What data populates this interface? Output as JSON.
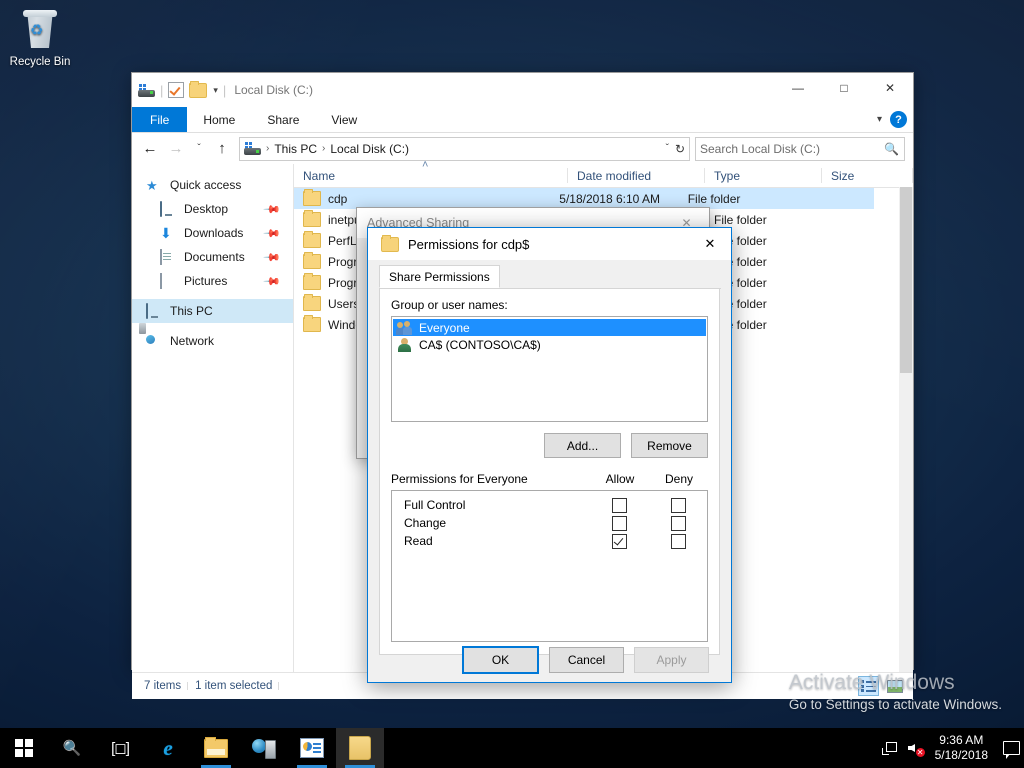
{
  "desktop": {
    "recycle_bin_label": "Recycle Bin",
    "recycle_bin_icon": "recycle-bin-icon",
    "watermark_line1": "Activate Windows",
    "watermark_line2": "Go to Settings to activate Windows."
  },
  "explorer": {
    "title": "Local Disk (C:)",
    "quick_access_icons": [
      "drive-icon",
      "properties-checkbox-icon",
      "new-folder-icon",
      "customize-caret-icon"
    ],
    "window_controls": {
      "minimize": "—",
      "maximize": "☐",
      "close": "✕"
    },
    "ribbon": {
      "tabs": [
        "File",
        "Home",
        "Share",
        "View"
      ],
      "collapse_caret": "ˇ",
      "help_label": "?"
    },
    "address": {
      "back": "←",
      "forward": "→",
      "recent_caret": "ˇ",
      "up": "↑",
      "drive_icon": "drive-icon",
      "crumbs": [
        "This PC",
        "Local Disk (C:)"
      ],
      "separator": "›",
      "dropdown_caret": "ˇ",
      "refresh": "↻"
    },
    "search": {
      "placeholder": "Search Local Disk (C:)",
      "icon": "search-icon"
    },
    "navigation": [
      {
        "label": "Quick access",
        "icon": "star-icon",
        "indent": false,
        "pinned": false,
        "selected": false
      },
      {
        "label": "Desktop",
        "icon": "desktop-icon",
        "indent": true,
        "pinned": true,
        "selected": false
      },
      {
        "label": "Downloads",
        "icon": "downloads-icon",
        "indent": true,
        "pinned": true,
        "selected": false
      },
      {
        "label": "Documents",
        "icon": "documents-icon",
        "indent": true,
        "pinned": true,
        "selected": false
      },
      {
        "label": "Pictures",
        "icon": "pictures-icon",
        "indent": true,
        "pinned": true,
        "selected": false
      },
      {
        "label": "This PC",
        "icon": "this-pc-icon",
        "indent": false,
        "pinned": false,
        "selected": true
      },
      {
        "label": "Network",
        "icon": "network-icon",
        "indent": false,
        "pinned": false,
        "selected": false
      }
    ],
    "columns": [
      "Name",
      "Date modified",
      "Type",
      "Size"
    ],
    "sort_indicator": "˄",
    "files": [
      {
        "name": "cdp",
        "date": "5/18/2018 6:10 AM",
        "type": "File folder",
        "size": "",
        "selected": true
      },
      {
        "name": "inetpub",
        "date": "",
        "type": "File folder",
        "size": "",
        "selected": false
      },
      {
        "name": "PerfLogs",
        "date": "",
        "type": "File folder",
        "size": "",
        "selected": false
      },
      {
        "name": "Program Files",
        "date": "",
        "type": "File folder",
        "size": "",
        "selected": false
      },
      {
        "name": "Program Files (x86)",
        "date": "",
        "type": "File folder",
        "size": "",
        "selected": false
      },
      {
        "name": "Users",
        "date": "",
        "type": "File folder",
        "size": "",
        "selected": false
      },
      {
        "name": "Windows",
        "date": "",
        "type": "File folder",
        "size": "",
        "selected": false
      }
    ],
    "status": {
      "item_count": "7 items",
      "selection": "1 item selected",
      "view_details_icon": "details-view-icon",
      "view_thumbnails_icon": "large-icons-view-icon"
    }
  },
  "advanced_sharing_dialog": {
    "title": "Advanced Sharing",
    "close": "✕"
  },
  "permissions_dialog": {
    "title": "Permissions for cdp$",
    "title_icon": "folder-icon",
    "close": "✕",
    "tab": "Share Permissions",
    "group_label": "Group or user names:",
    "users": [
      {
        "name": "Everyone",
        "icon": "group-icon",
        "selected": true
      },
      {
        "name": "CA$ (CONTOSO\\CA$)",
        "icon": "user-icon",
        "selected": false
      }
    ],
    "add_label": "Add...",
    "remove_label": "Remove",
    "permissions_for_label": "Permissions for Everyone",
    "allow_header": "Allow",
    "deny_header": "Deny",
    "permissions": [
      {
        "name": "Full Control",
        "allow": false,
        "deny": false
      },
      {
        "name": "Change",
        "allow": false,
        "deny": false
      },
      {
        "name": "Read",
        "allow": true,
        "deny": false
      }
    ],
    "ok_label": "OK",
    "cancel_label": "Cancel",
    "apply_label": "Apply",
    "apply_disabled": true
  },
  "taskbar": {
    "start_icon": "windows-start-icon",
    "search_icon": "search-icon",
    "task_view_icon": "task-view-icon",
    "apps": [
      {
        "name": "internet-explorer",
        "running": false,
        "active": false
      },
      {
        "name": "file-explorer",
        "running": true,
        "active": false
      },
      {
        "name": "server-manager",
        "running": false,
        "active": false
      },
      {
        "name": "management-console",
        "running": true,
        "active": false
      },
      {
        "name": "explorer-window",
        "running": true,
        "active": true
      }
    ],
    "tray": {
      "network_icon": "network-icon",
      "volume_icon": "volume-muted-icon",
      "time": "9:36 AM",
      "date": "5/18/2018",
      "action_center_icon": "action-center-icon"
    }
  },
  "colors": {
    "accent": "#0078d7",
    "selection": "#cce8ff",
    "list_selection": "#1e90ff",
    "taskbar": "#000000"
  }
}
